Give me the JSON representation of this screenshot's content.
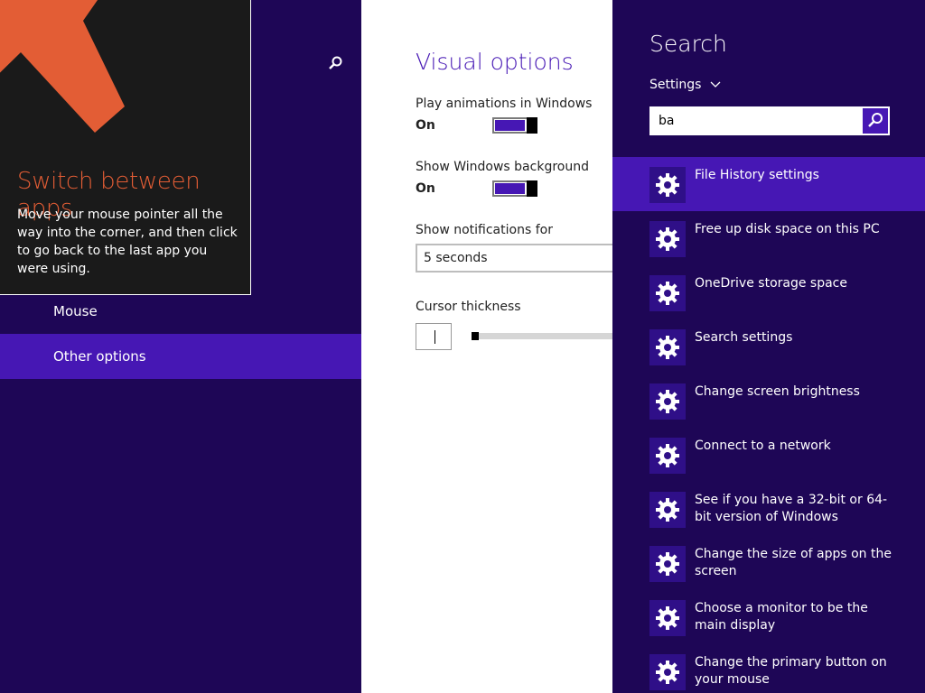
{
  "tip": {
    "title": "Switch between apps",
    "body": "Move your mouse pointer all the way into the corner, and then click to go back to the last app you were using."
  },
  "left_nav": {
    "items": [
      {
        "label": "Mouse",
        "selected": false
      },
      {
        "label": "Other options",
        "selected": true
      }
    ]
  },
  "visual_options": {
    "title": "Visual options",
    "animations": {
      "label": "Play animations in Windows",
      "state": "On"
    },
    "background": {
      "label": "Show Windows background",
      "state": "On"
    },
    "notifications": {
      "label": "Show notifications for",
      "value": "5 seconds"
    },
    "cursor": {
      "label": "Cursor thickness"
    }
  },
  "search_charm": {
    "title": "Search",
    "scope": "Settings",
    "query": "ba",
    "results": [
      {
        "label": "File History settings",
        "selected": true
      },
      {
        "label": "Free up disk space on this PC",
        "selected": false
      },
      {
        "label": "OneDrive storage space",
        "selected": false
      },
      {
        "label": "Search settings",
        "selected": false
      },
      {
        "label": "Change screen brightness",
        "selected": false
      },
      {
        "label": "Connect to a network",
        "selected": false
      },
      {
        "label": "See if you have a 32-bit or 64-bit version of Windows",
        "selected": false
      },
      {
        "label": "Change the size of apps on the screen",
        "selected": false
      },
      {
        "label": "Choose a monitor to be the main display",
        "selected": false
      },
      {
        "label": "Change the primary button on your mouse",
        "selected": false
      }
    ]
  },
  "colors": {
    "background": "#1e0656",
    "accent": "#4617b4",
    "tip_title": "#e35d35"
  }
}
